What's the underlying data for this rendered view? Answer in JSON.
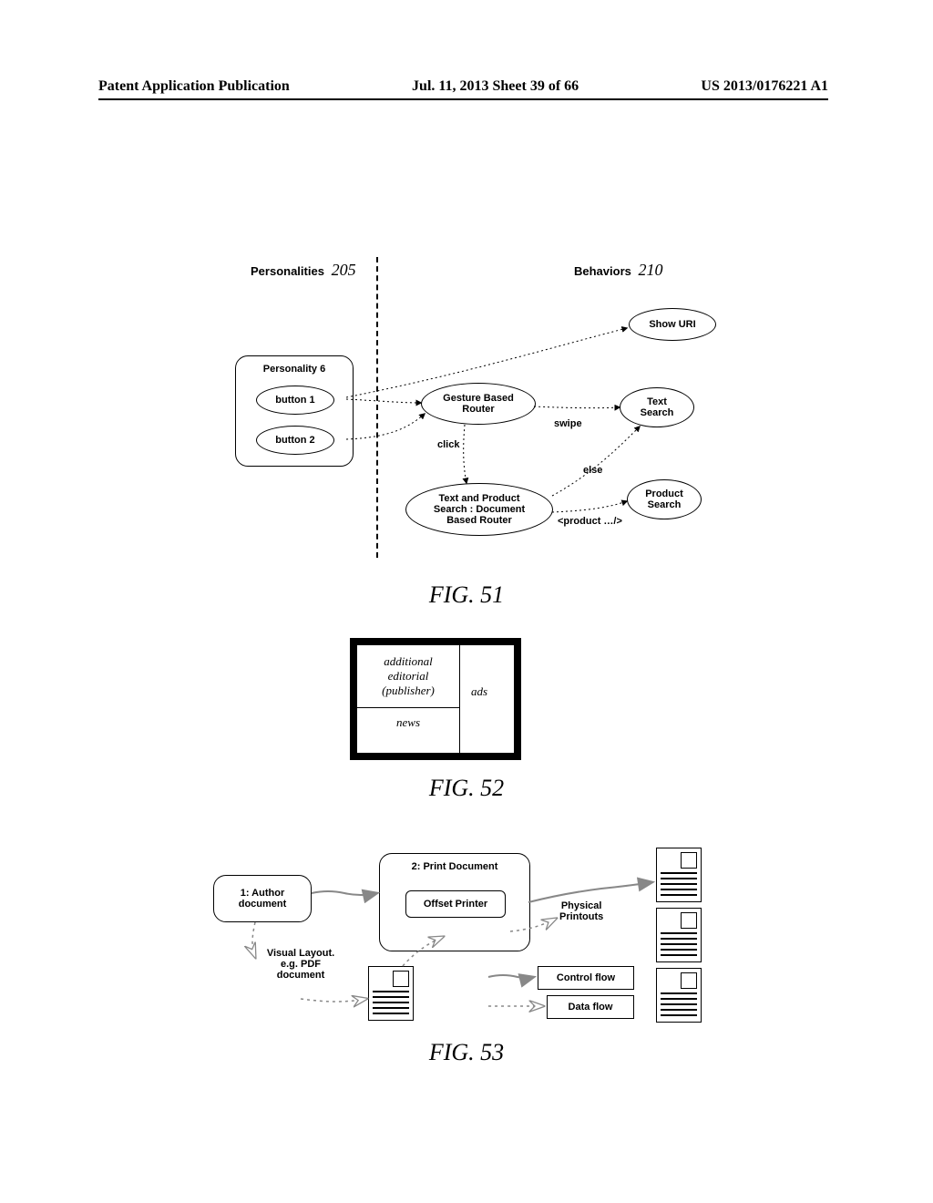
{
  "header": {
    "left": "Patent Application Publication",
    "center": "Jul. 11, 2013  Sheet 39 of 66",
    "right": "US 2013/0176221 A1"
  },
  "fig51": {
    "personalities_label": "Personalities",
    "personalities_ref": "205",
    "behaviors_label": "Behaviors",
    "behaviors_ref": "210",
    "personality6": "Personality 6",
    "button1": "button 1",
    "button2": "button 2",
    "gesture_router": "Gesture Based\nRouter",
    "text_product_router": "Text and Product\nSearch : Document\nBased Router",
    "show_uri": "Show URI",
    "text_search": "Text\nSearch",
    "product_search": "Product\nSearch",
    "edge_swipe": "swipe",
    "edge_click": "click",
    "edge_else": "else",
    "edge_product": "<product …/>",
    "caption": "FIG. 51"
  },
  "fig52": {
    "editorial": "additional\neditorial\n(publisher)",
    "news": "news",
    "ads": "ads",
    "caption": "FIG. 52"
  },
  "fig53": {
    "author": "1: Author\ndocument",
    "visual_layout": "Visual Layout.\ne.g. PDF\ndocument",
    "print_doc": "2: Print Document",
    "offset_printer": "Offset Printer",
    "physical_printouts": "Physical\nPrintouts",
    "control_flow": "Control flow",
    "data_flow": "Data flow",
    "caption": "FIG. 53"
  }
}
